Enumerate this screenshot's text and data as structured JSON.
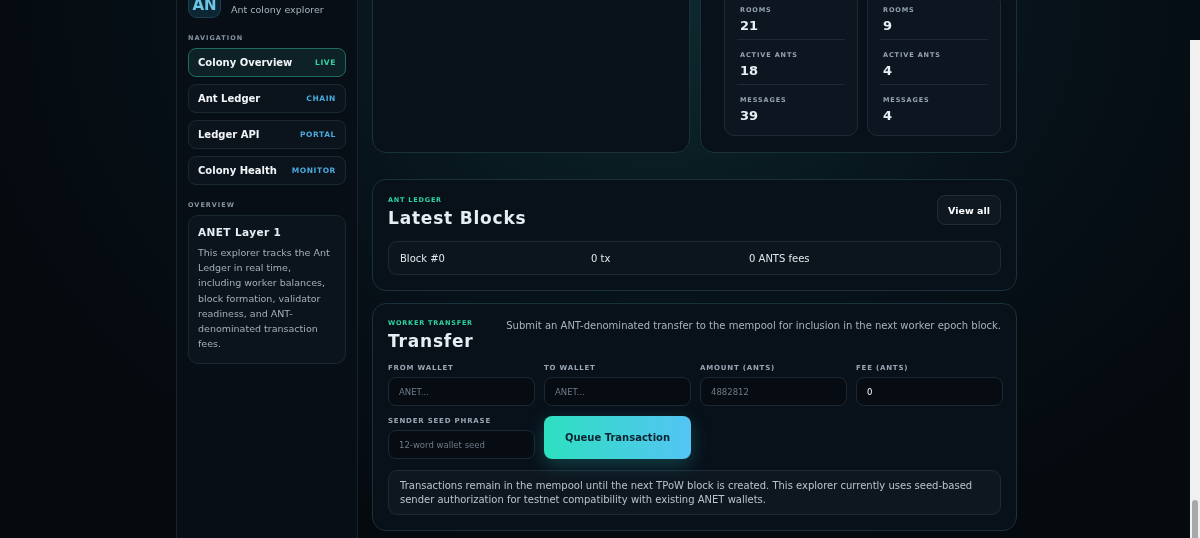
{
  "brand": {
    "logo": "AN",
    "tagline": "Ant colony explorer"
  },
  "navigation": {
    "heading": "NAVIGATION",
    "items": [
      {
        "label": "Colony Overview",
        "badge": "LIVE",
        "selected": true
      },
      {
        "label": "Ant Ledger",
        "badge": "CHAIN",
        "selected": false
      },
      {
        "label": "Ledger API",
        "badge": "PORTAL",
        "selected": false
      },
      {
        "label": "Colony Health",
        "badge": "MONITOR",
        "selected": false
      }
    ]
  },
  "overview": {
    "heading": "OVERVIEW",
    "title": "ANET Layer 1",
    "text": "This explorer tracks the Ant Ledger in real time, including worker balances, block formation, validator readiness, and ANT-denominated transaction fees."
  },
  "stats_cards": [
    {
      "rows": [
        {
          "label": "ROOMS",
          "value": "21"
        },
        {
          "label": "ACTIVE ANTS",
          "value": "18"
        },
        {
          "label": "MESSAGES",
          "value": "39"
        }
      ]
    },
    {
      "rows": [
        {
          "label": "ROOMS",
          "value": "9"
        },
        {
          "label": "ACTIVE ANTS",
          "value": "4"
        },
        {
          "label": "MESSAGES",
          "value": "4"
        }
      ]
    }
  ],
  "latest_blocks": {
    "eyebrow": "ANT LEDGER",
    "title": "Latest Blocks",
    "action": "View all",
    "blocks": [
      {
        "block": "Block #0",
        "tx": "0 tx",
        "fees": "0 ANTS fees"
      }
    ]
  },
  "transfer": {
    "eyebrow": "WORKER TRANSFER",
    "title": "Transfer",
    "description": "Submit an ANT-denominated transfer to the mempool for inclusion in the next worker epoch block.",
    "fields": [
      {
        "label": "FROM WALLET",
        "placeholder": "ANET..."
      },
      {
        "label": "TO WALLET",
        "placeholder": "ANET..."
      },
      {
        "label": "AMOUNT (ANTS)",
        "placeholder": "4882812"
      },
      {
        "label": "FEE (ANTS)",
        "value": "0"
      }
    ],
    "seed_field": {
      "label": "SENDER SEED PHRASE",
      "placeholder": "12-word wallet seed"
    },
    "button": "Queue Transaction",
    "note": "Transactions remain in the mempool until the next TPoW block is created. This explorer currently uses seed-based sender authorization for testnet compatibility with existing ANET wallets."
  }
}
